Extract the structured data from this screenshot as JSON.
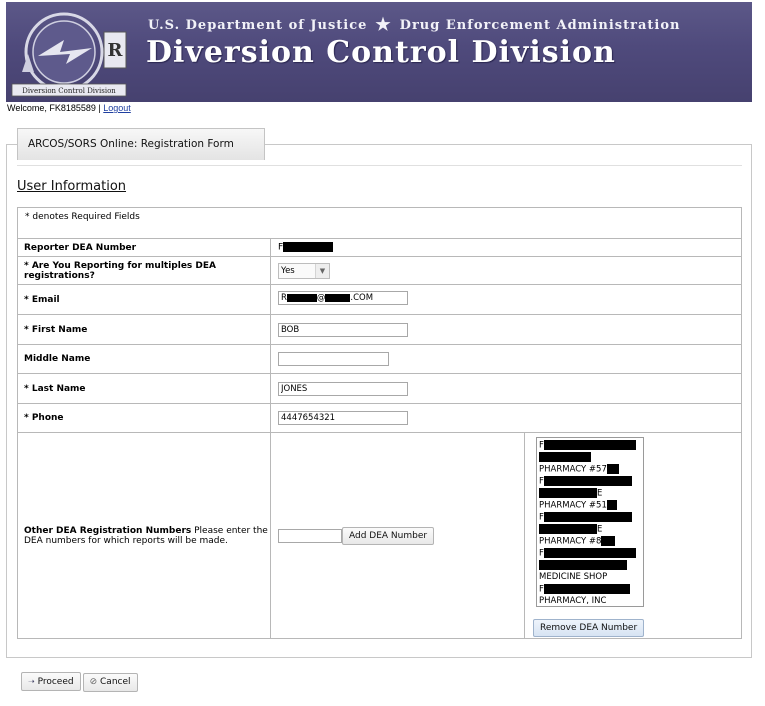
{
  "header": {
    "agency": "U.S. Department of Justice",
    "star": "★",
    "division": "Drug Enforcement Administration",
    "title": "Diversion Control Division",
    "seal_caption": "Diversion Control Division"
  },
  "session": {
    "welcome": "Welcome, FK8185589",
    "separator": "|",
    "logout": "Logout"
  },
  "form": {
    "tab_label": "ARCOS/SORS Online: Registration Form",
    "section_title": "User Information",
    "required_note": "* denotes Required Fields",
    "fields": {
      "reporter_dea": {
        "label": "Reporter DEA Number",
        "value_prefix": "F"
      },
      "multiple": {
        "label": "* Are You Reporting for multiples DEA registrations?",
        "value": "Yes"
      },
      "email": {
        "label": "* Email",
        "value_prefix": "R",
        "value_mid": "@",
        "value_suffix": ".COM"
      },
      "first_name": {
        "label": "* First Name",
        "value": "BOB"
      },
      "middle_name": {
        "label": "Middle Name",
        "value": ""
      },
      "last_name": {
        "label": "* Last Name",
        "value": "JONES"
      },
      "phone": {
        "label": "* Phone",
        "value": "4447654321"
      }
    },
    "other_dea": {
      "label_bold": "Other DEA Registration Numbers",
      "label_rest": " Please enter the DEA numbers for which reports will be made.",
      "input_value": "",
      "add_button": "Add DEA Number",
      "remove_button": "Remove DEA Number",
      "list": [
        {
          "line1": "F",
          "line2": "",
          "line3": "PHARMACY #57"
        },
        {
          "line1": "F",
          "line2": "E",
          "line3": "PHARMACY #51"
        },
        {
          "line1": "F",
          "line2": "E",
          "line3": "PHARMACY #8"
        },
        {
          "line1": "F",
          "line2": "",
          "line3": "MEDICINE SHOP"
        },
        {
          "line1": "F",
          "line2": "",
          "line3": "PHARMACY, INC"
        }
      ]
    }
  },
  "actions": {
    "proceed": "Proceed",
    "cancel": "Cancel",
    "proceed_icon": "arrow-right-icon",
    "cancel_icon": "cancel-icon"
  }
}
